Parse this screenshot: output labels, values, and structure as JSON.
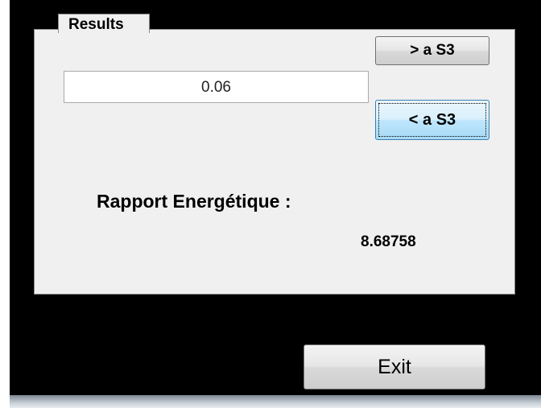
{
  "results_group": {
    "title": "Results"
  },
  "input_value": "0.06",
  "buttons": {
    "greater_label": "> a S3",
    "less_label": "< a S3",
    "exit_label": "Exit"
  },
  "rapport": {
    "label": "Rapport Energétique :",
    "value": "8.68758"
  }
}
